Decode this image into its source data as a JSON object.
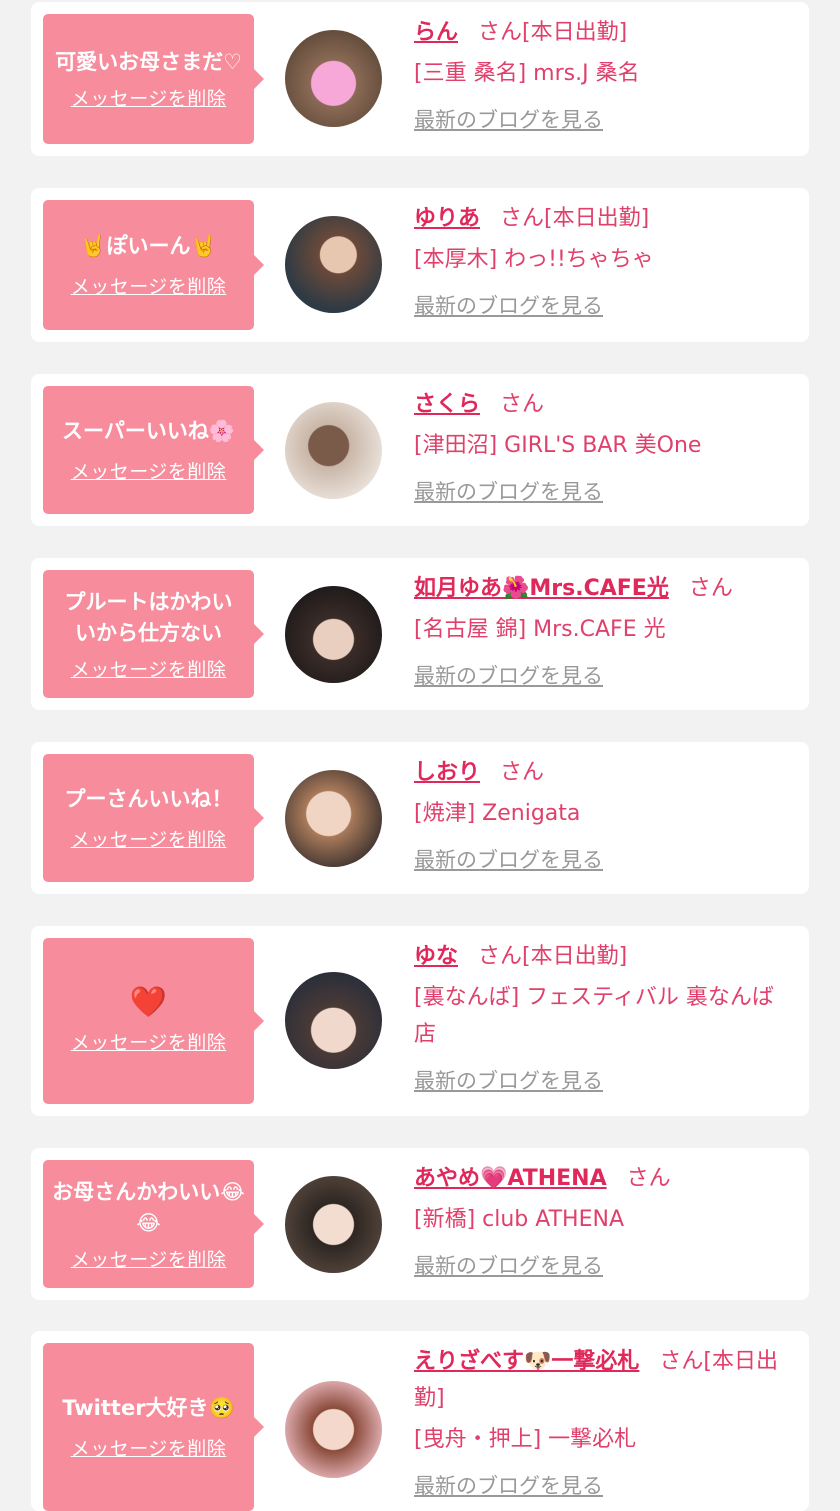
{
  "delete_label": "メッセージを削除",
  "blog_label": "最新のブログを見る",
  "items": [
    {
      "msg": "可愛いお母さまだ♡",
      "name": "らん",
      "suffix": "さん[本日出勤]",
      "shop": "[三重 桑名] mrs.J 桑名"
    },
    {
      "msg": "🤘ぽいーん🤘",
      "name": "ゆりあ",
      "suffix": "さん[本日出勤]",
      "shop": "[本厚木] わっ!!ちゃちゃ"
    },
    {
      "msg": "スーパーいいね🌸",
      "name": "さくら",
      "suffix": "さん",
      "shop": "[津田沼] GIRL'S BAR 美One"
    },
    {
      "msg": "プルートはかわいいから仕方ない",
      "name": "如月ゆあ🌺Mrs.CAFE光",
      "suffix": "さん",
      "shop": "[名古屋 錦] Mrs.CAFE 光"
    },
    {
      "msg": "プーさんいいね！",
      "name": "しおり",
      "suffix": "さん",
      "shop": "[焼津] Zenigata"
    },
    {
      "msg": "❤️",
      "name": "ゆな",
      "suffix": "さん[本日出勤]",
      "shop": "[裏なんば] フェスティバル 裏なんば店"
    },
    {
      "msg": "お母さんかわいい😂😂",
      "name": "あやめ💗ATHENA",
      "suffix": "さん",
      "shop": "[新橋] club ATHENA"
    },
    {
      "msg": "Twitter大好き🥺",
      "name": "えりざべす🐶一撃必札",
      "suffix": "さん[本日出勤]",
      "shop": "[曳舟・押上] 一撃必札"
    }
  ],
  "colors": {
    "bubble": "#f78c9c",
    "name": "#e0285a",
    "shop": "#e0406b",
    "blog": "#999999",
    "bg": "#f2f2f2"
  }
}
